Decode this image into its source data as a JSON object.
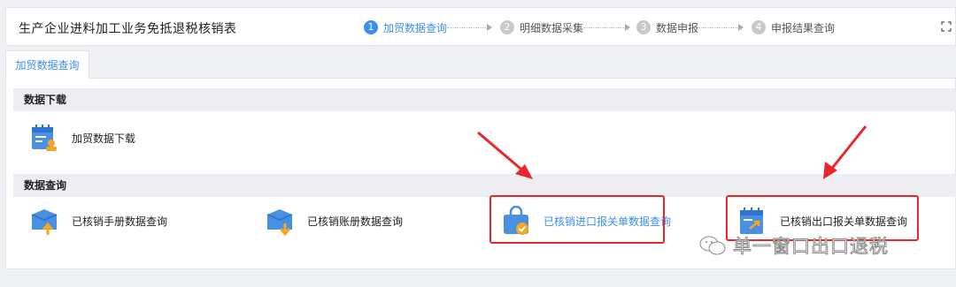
{
  "header": {
    "title": "生产企业进料加工业务免抵退税核销表",
    "steps": [
      {
        "num": "1",
        "label": "加贸数据查询",
        "active": true
      },
      {
        "num": "2",
        "label": "明细数据采集",
        "active": false
      },
      {
        "num": "3",
        "label": "数据申报",
        "active": false
      },
      {
        "num": "4",
        "label": "申报结果查询",
        "active": false
      }
    ]
  },
  "tabs": [
    {
      "label": "加贸数据查询"
    }
  ],
  "sections": [
    {
      "title": "数据下载",
      "items": [
        {
          "label": "加贸数据下载",
          "icon": "calendar-download-icon"
        }
      ]
    },
    {
      "title": "数据查询",
      "items": [
        {
          "label": "已核销手册数据查询",
          "icon": "box-upload-icon"
        },
        {
          "label": "已核销账册数据查询",
          "icon": "box-download-icon"
        },
        {
          "label": "已核销进口报关单数据查询",
          "icon": "shopping-bag-check-icon"
        },
        {
          "label": "已核销出口报关单数据查询",
          "icon": "calendar-export-icon"
        }
      ]
    }
  ],
  "watermark": {
    "text": "单一窗口出口退税"
  },
  "colors": {
    "accent": "#3b8ef0",
    "highlight": "#e8262b",
    "icon_blue": "#4a90e2",
    "icon_orange": "#f5a623"
  }
}
